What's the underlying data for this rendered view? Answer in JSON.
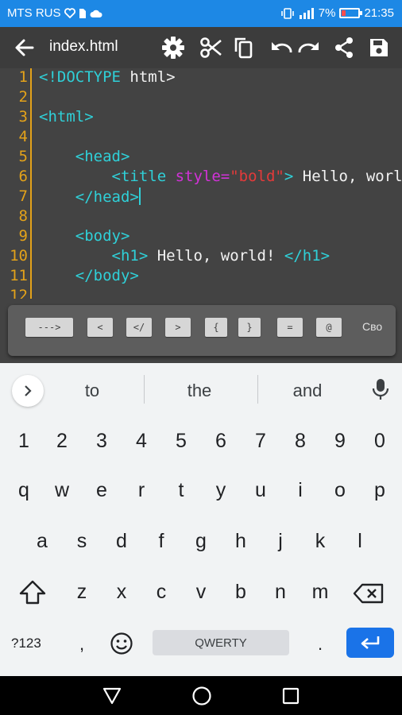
{
  "status_bar": {
    "carrier": "MTS RUS",
    "battery_percent": "7%",
    "time": "21:35",
    "battery_level": 0.07
  },
  "toolbar": {
    "title": "index.html",
    "buttons": [
      "back-icon",
      "gear-icon",
      "scissors-icon",
      "copy-icon",
      "undo-icon",
      "redo-icon",
      "share-icon",
      "save-icon"
    ]
  },
  "editor": {
    "line_numbers": [
      "1",
      "2",
      "3",
      "4",
      "5",
      "6",
      "7",
      "8",
      "9",
      "10",
      "11",
      "12"
    ],
    "lines": [
      {
        "tag": "<!DOCTYPE",
        "text": " html>"
      },
      {
        "text": ""
      },
      {
        "tag": "<html>"
      },
      {
        "text": ""
      },
      {
        "indent": "    ",
        "tag": "<head>"
      },
      {
        "indent": "        ",
        "tag": "<title",
        "attr": " style=",
        "str": "\"bold\"",
        "tag2": ">",
        "text": " Hello, world!"
      },
      {
        "indent": "    ",
        "tag": "</head>"
      },
      {
        "text": ""
      },
      {
        "indent": "    ",
        "tag": "<body>"
      },
      {
        "indent": "        ",
        "tag": "<h1>",
        "text": " Hello, world! ",
        "tag2": "</h1>"
      },
      {
        "indent": "    ",
        "tag": "</body>"
      }
    ]
  },
  "snippets": {
    "items": [
      "--->",
      "<",
      "</",
      ">",
      "{",
      "}",
      "=",
      "@"
    ],
    "more_label": "Сво"
  },
  "keyboard": {
    "suggestions": [
      "to",
      "the",
      "and"
    ],
    "row_numbers": [
      "1",
      "2",
      "3",
      "4",
      "5",
      "6",
      "7",
      "8",
      "9",
      "0"
    ],
    "row_1": [
      "q",
      "w",
      "e",
      "r",
      "t",
      "y",
      "u",
      "i",
      "o",
      "p"
    ],
    "row_2": [
      "a",
      "s",
      "d",
      "f",
      "g",
      "h",
      "j",
      "k",
      "l"
    ],
    "row_3": [
      "z",
      "x",
      "c",
      "v",
      "b",
      "n",
      "m"
    ],
    "symbols_label": "?123",
    "comma": ",",
    "space_label": "QWERTY",
    "period": "."
  },
  "colors": {
    "status_bar": "#1d88e5",
    "toolbar": "#3c3c3c",
    "editor_bg": "#434343",
    "line_number": "#e3a21a",
    "tag": "#2fd0d8",
    "attribute": "#d232d8",
    "string": "#e43a3a",
    "enter_key": "#1a73e8"
  }
}
